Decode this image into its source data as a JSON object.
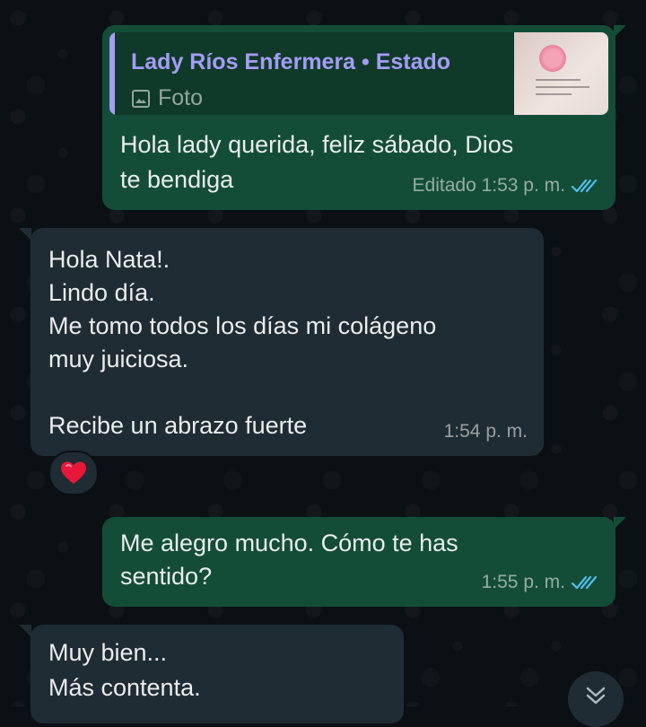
{
  "messages": [
    {
      "direction": "outgoing",
      "quote": {
        "author": "Lady Ríos Enfermera • Estado",
        "type_label": "Foto",
        "thumb_icon": "photo-thumbnail"
      },
      "text_lines": [
        "Hola lady querida, feliz sábado, Dios",
        "te bendiga"
      ],
      "time": "Editado 1:53 p. m.",
      "status": "read"
    },
    {
      "direction": "incoming",
      "text_lines": [
        "Hola Nata!.",
        "Lindo día.",
        "Me tomo todos los días mi colágeno",
        "muy juiciosa.",
        "",
        "Recibe un abrazo fuerte"
      ],
      "time": "1:54 p. m.",
      "reaction": "❤️"
    },
    {
      "direction": "outgoing",
      "text_lines": [
        "Me alegro mucho. Cómo te has",
        "sentido?"
      ],
      "time": "1:55 p. m.",
      "status": "read"
    },
    {
      "direction": "incoming",
      "text_lines": [
        "Muy bien...",
        "Más contenta."
      ]
    }
  ],
  "icons": {
    "read_receipt": "double-check-icon",
    "photo": "photo-icon",
    "scroll_down": "chevron-double-down-icon"
  },
  "colors": {
    "outgoing_bubble": "#144d37",
    "incoming_bubble": "#202c33",
    "read_ticks": "#53bdeb",
    "quote_accent": "#a59cf5",
    "background": "#0b1014"
  }
}
